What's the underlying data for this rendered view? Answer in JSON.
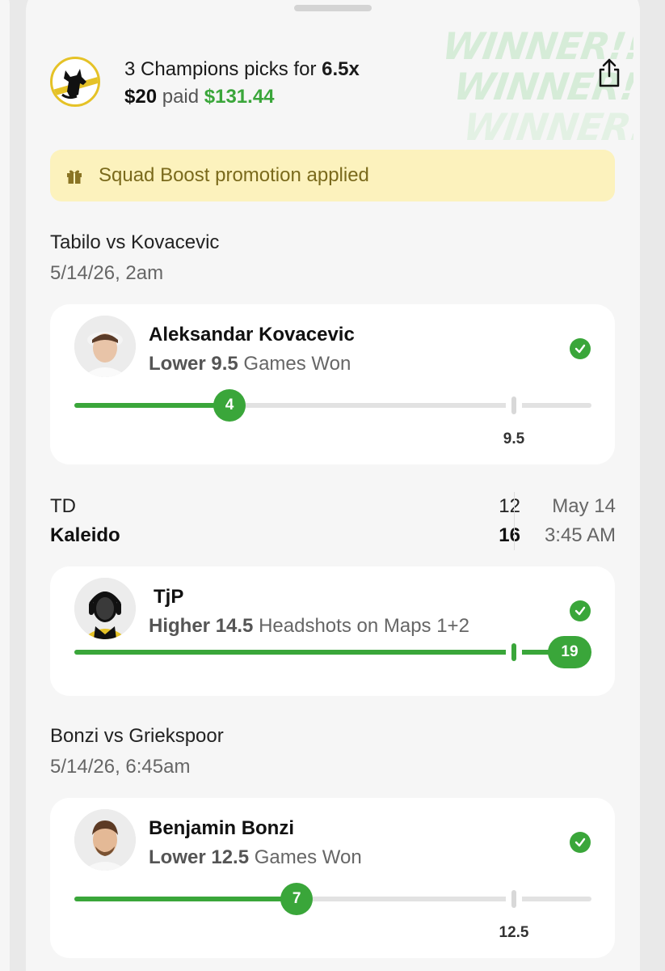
{
  "header": {
    "picks_text": "3 Champions picks for",
    "multiplier": "6.5x",
    "stake": "$20",
    "paid_word": "paid",
    "payout": "$131.44"
  },
  "winner_watermark": [
    "WINNER!!!",
    "WINNER!!",
    "WINNER!"
  ],
  "promo": {
    "text": "Squad Boost promotion applied",
    "icon": "gift-icon"
  },
  "colors": {
    "accent_green": "#3aa63a",
    "promo_bg": "#fcf2bd",
    "logo_gold": "#e5c227"
  },
  "matches": [
    {
      "title": "Tabilo vs Kovacevic",
      "date": "5/14/26, 2am"
    },
    {
      "title": "Bonzi vs Griekspoor",
      "date": "5/14/26, 6:45am"
    }
  ],
  "esports_match": {
    "team1": "TD",
    "team1_score": "12",
    "team2": "Kaleido",
    "team2_score": "16",
    "date": "May 14",
    "time": "3:45 AM"
  },
  "picks": [
    {
      "player": "Aleksandar Kovacevic",
      "direction": "Lower",
      "line": "9.5",
      "stat": "Games Won",
      "result": "4",
      "line_label": "9.5",
      "progress_pct": 30,
      "line_pct": 85,
      "status": "won"
    },
    {
      "player": "TjP",
      "direction": "Higher",
      "line": "14.5",
      "stat": "Headshots on Maps 1+2",
      "result": "19",
      "progress_pct": 100,
      "line_pct": 85,
      "status": "won"
    },
    {
      "player": "Benjamin Bonzi",
      "direction": "Lower",
      "line": "12.5",
      "stat": "Games Won",
      "result": "7",
      "line_label": "12.5",
      "progress_pct": 43,
      "line_pct": 85,
      "status": "won"
    }
  ]
}
